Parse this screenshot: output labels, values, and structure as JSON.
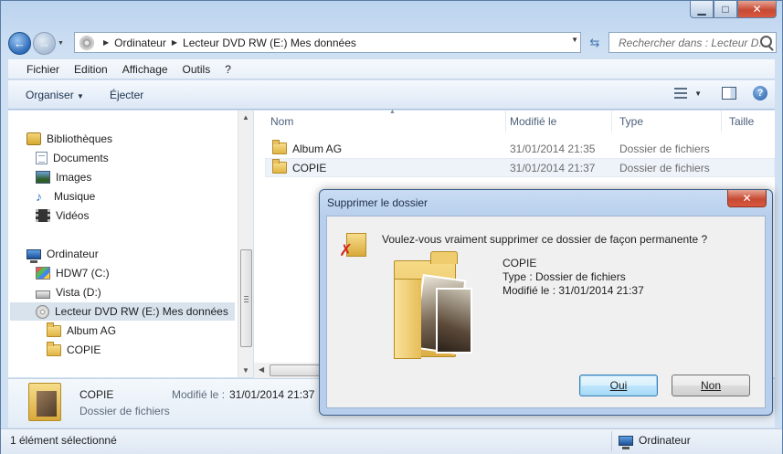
{
  "window": {
    "minimize": "▁",
    "maximize": "□",
    "close": "✕"
  },
  "address": {
    "crumbs": [
      "Ordinateur",
      "Lecteur DVD RW (E:) Mes données"
    ]
  },
  "search": {
    "placeholder": "Rechercher dans : Lecteur D..."
  },
  "menu": [
    "Fichier",
    "Edition",
    "Affichage",
    "Outils",
    "?"
  ],
  "toolbar": {
    "organize": "Organiser",
    "eject": "Éjecter",
    "help": "?"
  },
  "nav": {
    "libraries": "Bibliothèques",
    "documents": "Documents",
    "images": "Images",
    "music": "Musique",
    "videos": "Vidéos",
    "computer": "Ordinateur",
    "drive_c": "HDW7 (C:)",
    "drive_d": "Vista (D:)",
    "drive_e": "Lecteur DVD RW (E:) Mes données",
    "folder1": "Album AG",
    "folder2": "COPIE"
  },
  "columns": {
    "name": "Nom",
    "modified": "Modifié le",
    "type": "Type",
    "size": "Taille"
  },
  "files": [
    {
      "name": "Album AG",
      "modified": "31/01/2014 21:35",
      "type": "Dossier de fichiers"
    },
    {
      "name": "COPIE",
      "modified": "31/01/2014 21:37",
      "type": "Dossier de fichiers"
    }
  ],
  "details": {
    "name": "COPIE",
    "type": "Dossier de fichiers",
    "modified_label": "Modifié le :",
    "modified_value": "31/01/2014 21:37"
  },
  "status": {
    "selection": "1 élément sélectionné",
    "location": "Ordinateur"
  },
  "dialog": {
    "title": "Supprimer le dossier",
    "close": "✕",
    "question": "Voulez-vous vraiment supprimer ce dossier de façon permanente ?",
    "item_name": "COPIE",
    "item_type": "Type : Dossier de fichiers",
    "item_modified": "Modifié le : 31/01/2014 21:37",
    "yes_label": "Oui",
    "no_label": "Non"
  }
}
